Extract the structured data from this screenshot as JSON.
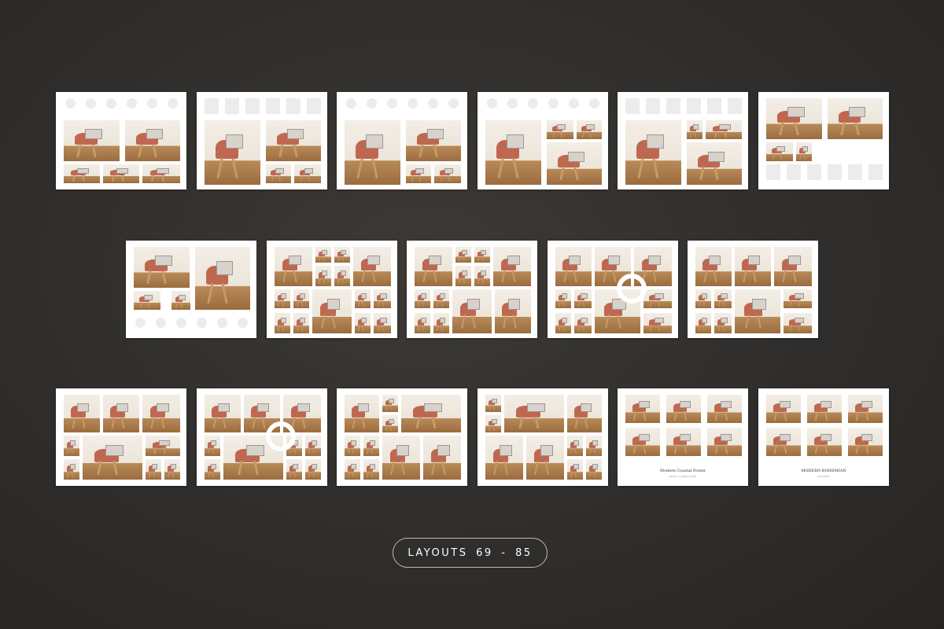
{
  "label": "LAYOUTS 69 - 85",
  "colors": {
    "background": "#2f2d2b",
    "card": "#ffffff",
    "placeholder": "#ececec",
    "chair": "#c0674f",
    "floor": "#a8784a"
  },
  "posters": [
    {
      "title": "Modern Coastal Poster",
      "subtitle": "BOHO LANDSCAPE"
    },
    {
      "title": "MODERN BOHEMIAN",
      "subtitle": "POSTER"
    }
  ]
}
